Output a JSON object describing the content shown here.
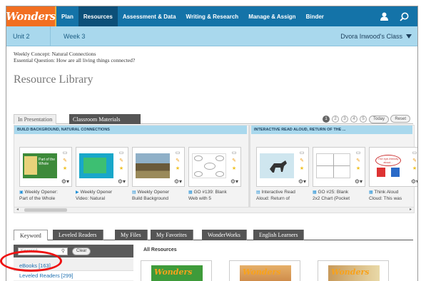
{
  "nav": {
    "logo": "Wonders",
    "items": [
      "Plan",
      "Resources",
      "Assessment & Data",
      "Writing & Research",
      "Manage & Assign",
      "Binder"
    ],
    "active": "Resources"
  },
  "unitbar": {
    "unit": "Unit 2",
    "week": "Week 3",
    "class": "Dvora Inwood's Class"
  },
  "concept": {
    "weekly_label": "Weekly Concept:",
    "weekly_value": "Natural Connections",
    "eq_label": "Essential Question:",
    "eq_value": "How are all living things connected?"
  },
  "page_title": "Resource Library",
  "presentation_tabs": [
    "In Presentation",
    "Classroom Materials"
  ],
  "pager": {
    "pages": [
      "1",
      "2",
      "3",
      "4",
      "5"
    ],
    "today": "Today",
    "reset": "Reset"
  },
  "sections": [
    "BUILD BACKGROUND, NATURAL CONNECTIONS",
    "INTERACTIVE READ ALOUD, RETURN OF THE ..."
  ],
  "cards": [
    {
      "line1": "Weekly Opener:",
      "line2": "Part of the Whole",
      "thumb": "Part of the Whole",
      "icon": "book-icon"
    },
    {
      "line1": "Weekly Opener",
      "line2": "Video: Natural",
      "thumb": "",
      "icon": "video-icon"
    },
    {
      "line1": "Weekly Opener",
      "line2": "Build Background",
      "thumb": "",
      "icon": "image-icon"
    },
    {
      "line1": "GO #139: Blank",
      "line2": "Web with 5",
      "thumb": "",
      "icon": "doc-icon"
    },
    {
      "line1": "Interactive Read",
      "line2": "Aloud: Return of",
      "thumb": "",
      "icon": "image-icon"
    },
    {
      "line1": "GO #25: Blank",
      "line2": "2x2 Chart (Pocket",
      "thumb": "",
      "icon": "doc-icon"
    },
    {
      "line1": "Think Aloud",
      "line2": "Cloud: This was",
      "thumb": "The eye-friendly about...",
      "icon": "doc-icon"
    }
  ],
  "bottom_tabs": [
    "Keyword",
    "Leveled Readers",
    "My Files",
    "My Favorites",
    "WonderWorks",
    "English Learners"
  ],
  "search": {
    "placeholder": "Keyword",
    "clear": "Clear"
  },
  "filters": [
    "eBooks [163]",
    "Leveled Readers [299]"
  ],
  "all_resources": "All Resources",
  "books": [
    "Wonders",
    "Wonders",
    "Wonders"
  ],
  "colors": {
    "nav": "#1473a8",
    "logo": "#f26f21",
    "unitbar": "#a9d8ed",
    "highlight": "#e11111"
  }
}
